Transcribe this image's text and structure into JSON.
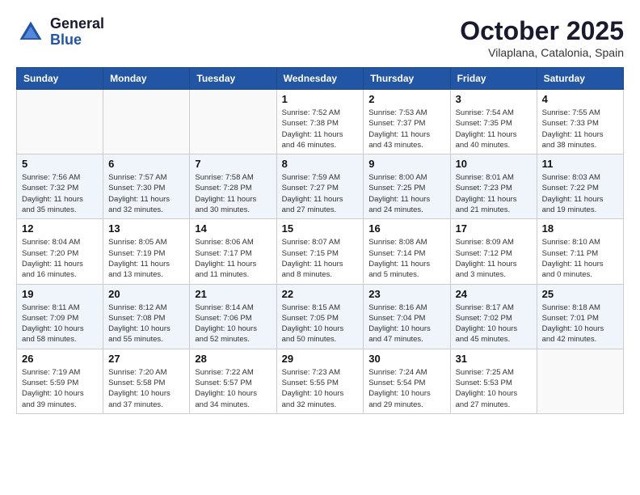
{
  "header": {
    "logo_general": "General",
    "logo_blue": "Blue",
    "month_title": "October 2025",
    "location": "Vilaplana, Catalonia, Spain"
  },
  "weekdays": [
    "Sunday",
    "Monday",
    "Tuesday",
    "Wednesday",
    "Thursday",
    "Friday",
    "Saturday"
  ],
  "weeks": [
    [
      {
        "day": "",
        "info": ""
      },
      {
        "day": "",
        "info": ""
      },
      {
        "day": "",
        "info": ""
      },
      {
        "day": "1",
        "info": "Sunrise: 7:52 AM\nSunset: 7:38 PM\nDaylight: 11 hours\nand 46 minutes."
      },
      {
        "day": "2",
        "info": "Sunrise: 7:53 AM\nSunset: 7:37 PM\nDaylight: 11 hours\nand 43 minutes."
      },
      {
        "day": "3",
        "info": "Sunrise: 7:54 AM\nSunset: 7:35 PM\nDaylight: 11 hours\nand 40 minutes."
      },
      {
        "day": "4",
        "info": "Sunrise: 7:55 AM\nSunset: 7:33 PM\nDaylight: 11 hours\nand 38 minutes."
      }
    ],
    [
      {
        "day": "5",
        "info": "Sunrise: 7:56 AM\nSunset: 7:32 PM\nDaylight: 11 hours\nand 35 minutes."
      },
      {
        "day": "6",
        "info": "Sunrise: 7:57 AM\nSunset: 7:30 PM\nDaylight: 11 hours\nand 32 minutes."
      },
      {
        "day": "7",
        "info": "Sunrise: 7:58 AM\nSunset: 7:28 PM\nDaylight: 11 hours\nand 30 minutes."
      },
      {
        "day": "8",
        "info": "Sunrise: 7:59 AM\nSunset: 7:27 PM\nDaylight: 11 hours\nand 27 minutes."
      },
      {
        "day": "9",
        "info": "Sunrise: 8:00 AM\nSunset: 7:25 PM\nDaylight: 11 hours\nand 24 minutes."
      },
      {
        "day": "10",
        "info": "Sunrise: 8:01 AM\nSunset: 7:23 PM\nDaylight: 11 hours\nand 21 minutes."
      },
      {
        "day": "11",
        "info": "Sunrise: 8:03 AM\nSunset: 7:22 PM\nDaylight: 11 hours\nand 19 minutes."
      }
    ],
    [
      {
        "day": "12",
        "info": "Sunrise: 8:04 AM\nSunset: 7:20 PM\nDaylight: 11 hours\nand 16 minutes."
      },
      {
        "day": "13",
        "info": "Sunrise: 8:05 AM\nSunset: 7:19 PM\nDaylight: 11 hours\nand 13 minutes."
      },
      {
        "day": "14",
        "info": "Sunrise: 8:06 AM\nSunset: 7:17 PM\nDaylight: 11 hours\nand 11 minutes."
      },
      {
        "day": "15",
        "info": "Sunrise: 8:07 AM\nSunset: 7:15 PM\nDaylight: 11 hours\nand 8 minutes."
      },
      {
        "day": "16",
        "info": "Sunrise: 8:08 AM\nSunset: 7:14 PM\nDaylight: 11 hours\nand 5 minutes."
      },
      {
        "day": "17",
        "info": "Sunrise: 8:09 AM\nSunset: 7:12 PM\nDaylight: 11 hours\nand 3 minutes."
      },
      {
        "day": "18",
        "info": "Sunrise: 8:10 AM\nSunset: 7:11 PM\nDaylight: 11 hours\nand 0 minutes."
      }
    ],
    [
      {
        "day": "19",
        "info": "Sunrise: 8:11 AM\nSunset: 7:09 PM\nDaylight: 10 hours\nand 58 minutes."
      },
      {
        "day": "20",
        "info": "Sunrise: 8:12 AM\nSunset: 7:08 PM\nDaylight: 10 hours\nand 55 minutes."
      },
      {
        "day": "21",
        "info": "Sunrise: 8:14 AM\nSunset: 7:06 PM\nDaylight: 10 hours\nand 52 minutes."
      },
      {
        "day": "22",
        "info": "Sunrise: 8:15 AM\nSunset: 7:05 PM\nDaylight: 10 hours\nand 50 minutes."
      },
      {
        "day": "23",
        "info": "Sunrise: 8:16 AM\nSunset: 7:04 PM\nDaylight: 10 hours\nand 47 minutes."
      },
      {
        "day": "24",
        "info": "Sunrise: 8:17 AM\nSunset: 7:02 PM\nDaylight: 10 hours\nand 45 minutes."
      },
      {
        "day": "25",
        "info": "Sunrise: 8:18 AM\nSunset: 7:01 PM\nDaylight: 10 hours\nand 42 minutes."
      }
    ],
    [
      {
        "day": "26",
        "info": "Sunrise: 7:19 AM\nSunset: 5:59 PM\nDaylight: 10 hours\nand 39 minutes."
      },
      {
        "day": "27",
        "info": "Sunrise: 7:20 AM\nSunset: 5:58 PM\nDaylight: 10 hours\nand 37 minutes."
      },
      {
        "day": "28",
        "info": "Sunrise: 7:22 AM\nSunset: 5:57 PM\nDaylight: 10 hours\nand 34 minutes."
      },
      {
        "day": "29",
        "info": "Sunrise: 7:23 AM\nSunset: 5:55 PM\nDaylight: 10 hours\nand 32 minutes."
      },
      {
        "day": "30",
        "info": "Sunrise: 7:24 AM\nSunset: 5:54 PM\nDaylight: 10 hours\nand 29 minutes."
      },
      {
        "day": "31",
        "info": "Sunrise: 7:25 AM\nSunset: 5:53 PM\nDaylight: 10 hours\nand 27 minutes."
      },
      {
        "day": "",
        "info": ""
      }
    ]
  ]
}
